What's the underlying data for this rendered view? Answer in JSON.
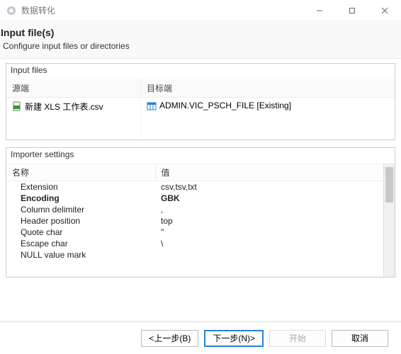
{
  "window": {
    "title": "数据转化"
  },
  "header": {
    "title": "Input file(s)",
    "subtitle": "Configure input files or directories"
  },
  "groups": {
    "input_files": {
      "legend": "Input files",
      "columns": {
        "source": "源端",
        "target": "目标端"
      },
      "row": {
        "source_name": "新建 XLS 工作表.csv",
        "target_name": "ADMIN.VIC_PSCH_FILE [Existing]"
      }
    },
    "importer": {
      "legend": "Importer settings",
      "columns": {
        "name": "名称",
        "value": "值"
      },
      "rows": [
        {
          "name": "Extension",
          "value": "csv,tsv,txt",
          "bold": false
        },
        {
          "name": "Encoding",
          "value": "GBK",
          "bold": true
        },
        {
          "name": "Column delimiter",
          "value": ",",
          "bold": false
        },
        {
          "name": "Header position",
          "value": "top",
          "bold": false
        },
        {
          "name": "Quote char",
          "value": "\"",
          "bold": false
        },
        {
          "name": "Escape char",
          "value": "\\",
          "bold": false
        },
        {
          "name": "NULL value mark",
          "value": "",
          "bold": false
        }
      ]
    }
  },
  "footer": {
    "back": "<上一步(B)",
    "next": "下一步(N)>",
    "start": "开始",
    "cancel": "取消"
  }
}
